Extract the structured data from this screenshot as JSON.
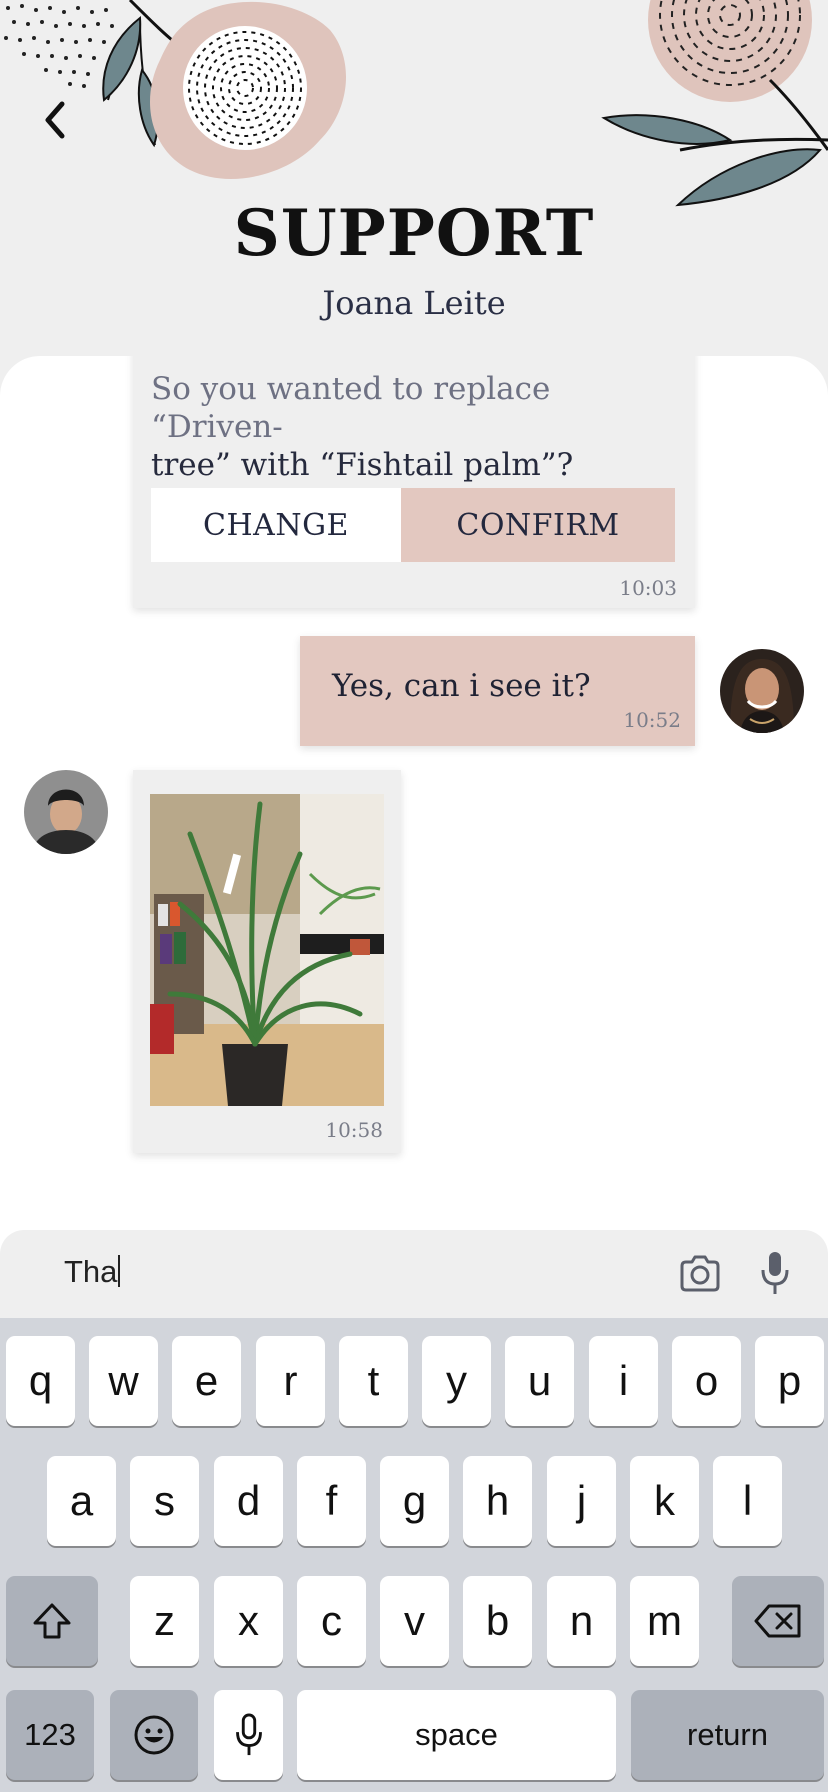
{
  "header": {
    "title": "SUPPORT",
    "subtitle": "Joana Leite"
  },
  "messages": {
    "confirm": {
      "text_muted": "So you wanted to replace “Driven-",
      "text_dark": "tree” with “Fishtail palm”?",
      "change_label": "CHANGE",
      "confirm_label": "CONFIRM",
      "time": "10:03"
    },
    "reply": {
      "text": "Yes, can i see it?",
      "time": "10:52"
    },
    "photo": {
      "time": "10:58"
    }
  },
  "composer": {
    "value": "Tha"
  },
  "keyboard": {
    "row1": [
      "q",
      "w",
      "e",
      "r",
      "t",
      "y",
      "u",
      "i",
      "o",
      "p"
    ],
    "row2": [
      "a",
      "s",
      "d",
      "f",
      "g",
      "h",
      "j",
      "k",
      "l"
    ],
    "row3": [
      "z",
      "x",
      "c",
      "v",
      "b",
      "n",
      "m"
    ],
    "numbers_label": "123",
    "space_label": "space",
    "return_label": "return"
  },
  "colors": {
    "accent_pink": "#e3c8c0",
    "background": "#efefef",
    "leaf": "#6e878d"
  }
}
